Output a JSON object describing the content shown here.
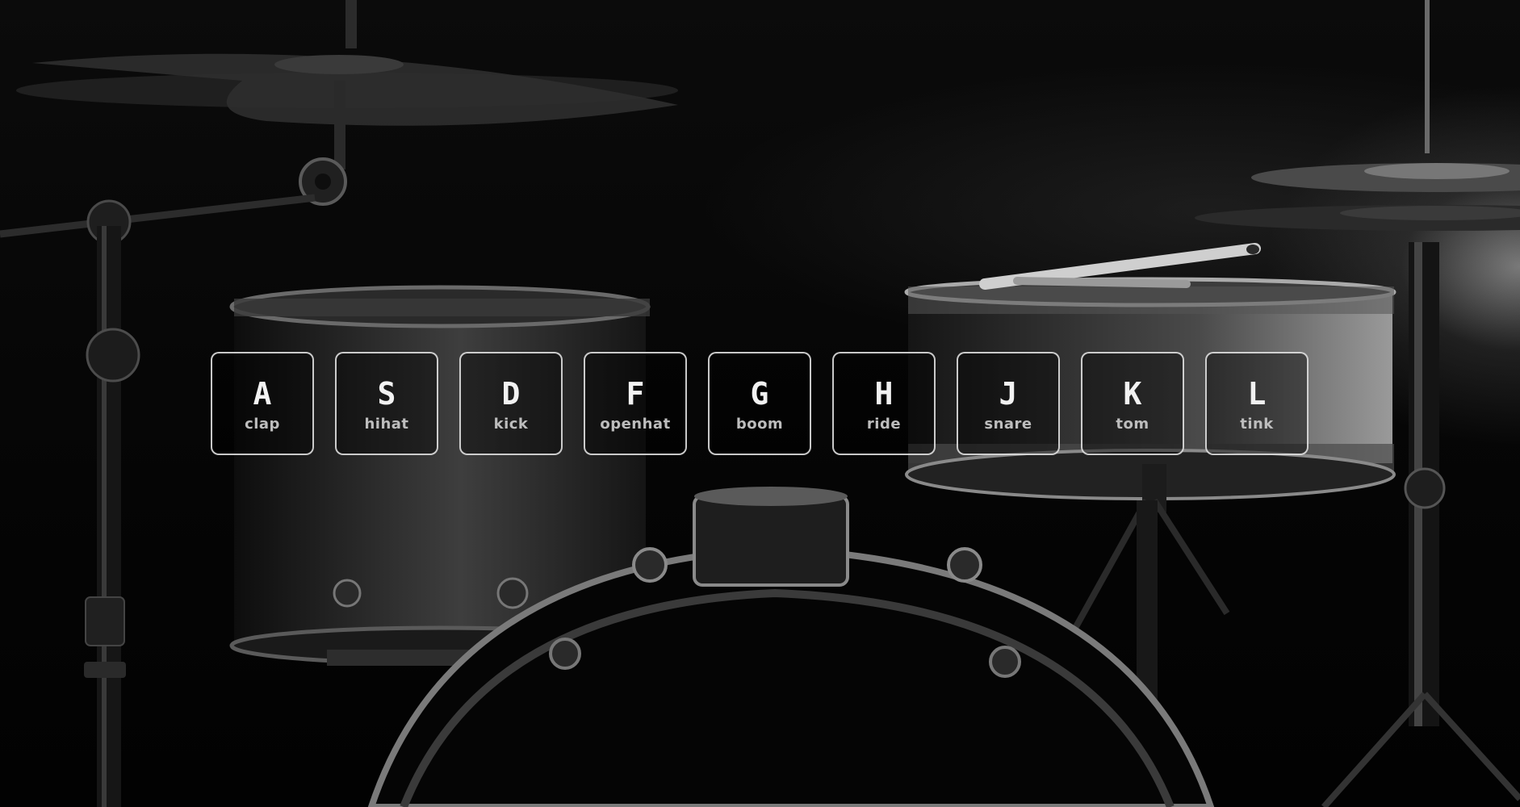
{
  "keys": [
    {
      "key": "A",
      "sound": "clap"
    },
    {
      "key": "S",
      "sound": "hihat"
    },
    {
      "key": "D",
      "sound": "kick"
    },
    {
      "key": "F",
      "sound": "openhat"
    },
    {
      "key": "G",
      "sound": "boom"
    },
    {
      "key": "H",
      "sound": "ride"
    },
    {
      "key": "J",
      "sound": "snare"
    },
    {
      "key": "K",
      "sound": "tom"
    },
    {
      "key": "L",
      "sound": "tink"
    }
  ]
}
